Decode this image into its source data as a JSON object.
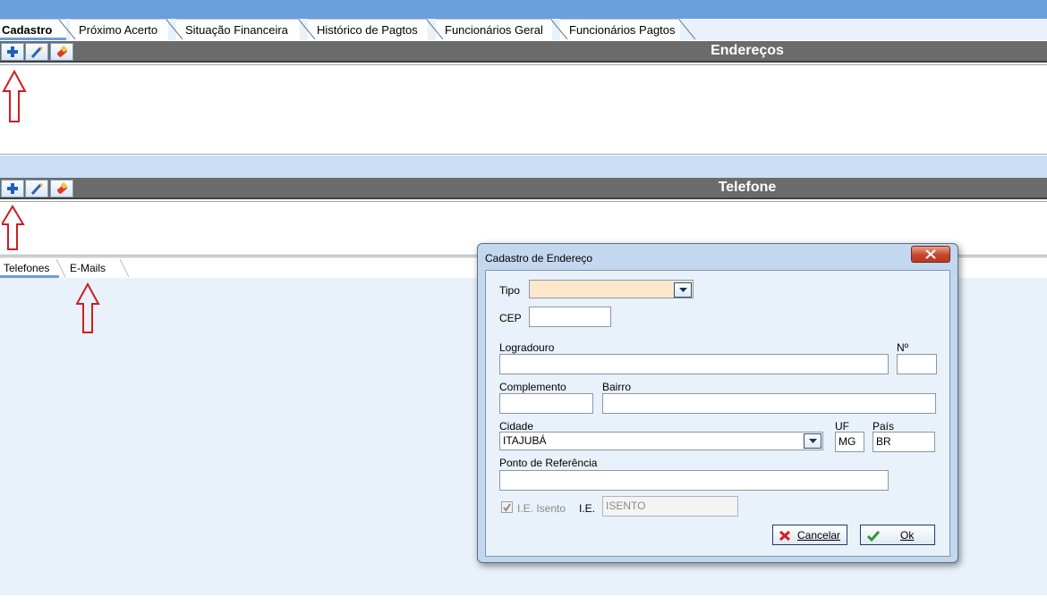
{
  "tabs": [
    {
      "label": "Cadastro",
      "active": true
    },
    {
      "label": "Próximo Acerto"
    },
    {
      "label": "Situação Financeira"
    },
    {
      "label": "Histórico de Pagtos"
    },
    {
      "label": "Funcionários Geral"
    },
    {
      "label": "Funcionários Pagtos"
    }
  ],
  "sections": {
    "enderecos": {
      "title": "Endereços"
    },
    "telefone": {
      "title": "Telefone"
    }
  },
  "toolbar_icons": [
    "add-icon",
    "edit-icon",
    "delete-icon"
  ],
  "subtabs": [
    {
      "label": "Telefones",
      "active": true
    },
    {
      "label": "E-Mails"
    }
  ],
  "dialog": {
    "title": "Cadastro de Endereço",
    "fields": {
      "tipo": {
        "label": "Tipo",
        "value": ""
      },
      "cep": {
        "label": "CEP",
        "value": ""
      },
      "logradouro": {
        "label": "Logradouro",
        "value": ""
      },
      "numero": {
        "label": "Nº",
        "value": ""
      },
      "complemento": {
        "label": "Complemento",
        "value": ""
      },
      "bairro": {
        "label": "Bairro",
        "value": ""
      },
      "cidade": {
        "label": "Cidade",
        "value": "ITAJUBÁ"
      },
      "uf": {
        "label": "UF",
        "value": "MG"
      },
      "pais": {
        "label": "País",
        "value": "BR"
      },
      "ponto_referencia": {
        "label": "Ponto de Referência",
        "value": ""
      },
      "ie_isento": {
        "label": "I.E. Isento",
        "checked": true
      },
      "ie": {
        "label": "I.E.",
        "value": "ISENTO"
      }
    },
    "buttons": {
      "cancel": "Cancelar",
      "ok": "Ok"
    }
  },
  "colors": {
    "topbar": "#6a9fdc",
    "section_header": "#6b6b6b",
    "annotation_arrow": "#cc1f1f",
    "tipo_field": "#fde8cc"
  }
}
